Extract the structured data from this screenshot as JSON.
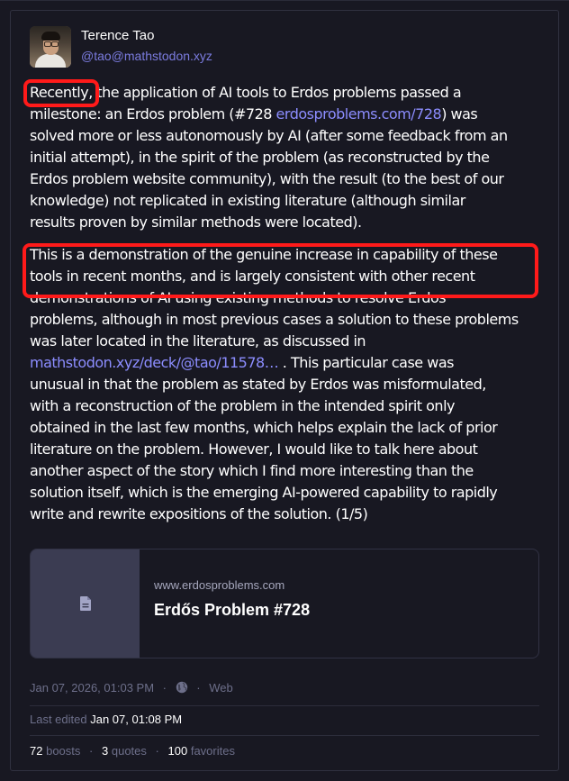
{
  "author": {
    "name": "Terence Tao",
    "handle": "@tao@mathstodon.xyz"
  },
  "post": {
    "p1": {
      "l1a": "Recently,",
      "l1b": " the application of AI tools to Erdos problems passed a",
      "l2a": "milestone: an Erdos problem (#728 ",
      "l2link": "erdosproblems.com/728",
      "l2b": ") was",
      "l3": "solved more or less autonomously by AI (after some feedback from an",
      "l4": "initial attempt), in the spirit of the problem (as reconstructed by the",
      "l5": "Erdos problem website community), with the result (to the best of our",
      "l6": "knowledge) not replicated in existing literature (although similar",
      "l7": "results proven by similar methods were located)."
    },
    "p2": {
      "l1": "This is a demonstration of the genuine increase in capability of these",
      "l2": "tools in recent months, and is largely consistent with other recent",
      "l3": "demonstrations of AI using existing methods to resolve Erdos",
      "l4": "problems, although in most previous cases a solution to these problems",
      "l5": "was later located in the literature, as discussed in",
      "l6link": "mathstodon.xyz/deck/@tao/11578…",
      "l6b": " .  This particular case was",
      "l7": "unusual in that the problem as stated by Erdos was misformulated,",
      "l8": "with a reconstruction of the problem in the intended spirit only",
      "l9": "obtained in the last few months, which helps explain the lack of prior",
      "l10": "literature on the problem.  However, I would like to talk here about",
      "l11": "another aspect of the story which I find more interesting than the",
      "l12": "solution itself, which is the emerging AI-powered capability to rapidly",
      "l13": "write and rewrite expositions of the solution.  (1/5)"
    }
  },
  "link_card": {
    "domain": "www.erdosproblems.com",
    "title": "Erdős Problem #728",
    "icon": "document-icon"
  },
  "meta": {
    "timestamp": "Jan 07, 2026, 01:03 PM",
    "visibility_icon": "globe-icon",
    "dot": "·",
    "client": "Web",
    "edited_label": "Last edited",
    "edited_time": "Jan 07, 01:08 PM"
  },
  "stats": {
    "boosts_count": "72",
    "boosts_label": "boosts",
    "quotes_count": "3",
    "quotes_label": "quotes",
    "favorites_count": "100",
    "favorites_label": "favorites"
  },
  "colors": {
    "background": "#181822",
    "link": "#8c8dff",
    "muted": "#6d6f8a",
    "highlight": "#ff1a1a"
  }
}
